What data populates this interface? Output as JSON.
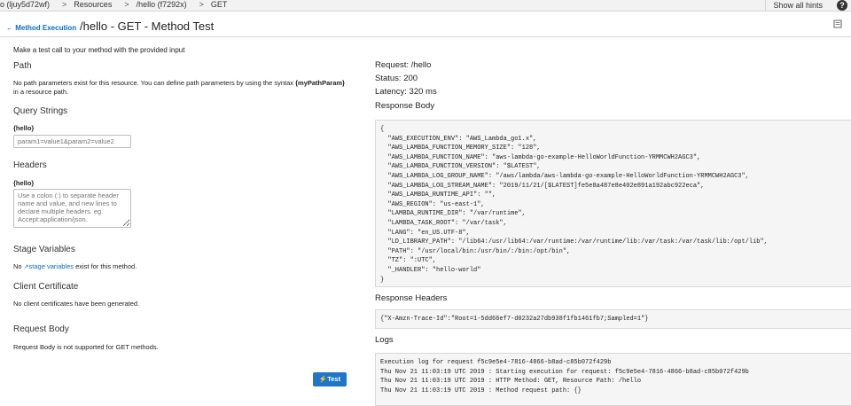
{
  "breadcrumb": {
    "api": "o (ljuy5d72wf)",
    "resources": "Resources",
    "resource": "/hello (f7292x)",
    "method": "GET",
    "sep": ">"
  },
  "header": {
    "show_hints": "Show all hints",
    "help": "?",
    "back_label": "Method Execution",
    "title": "/hello - GET - Method Test"
  },
  "left": {
    "intro": "Make a test call to your method with the provided input",
    "path_title": "Path",
    "path_desc_1": "No path parameters exist for this resource. You can define path parameters by using the syntax ",
    "path_syntax": "{myPathParam}",
    "path_desc_2": "in a resource path.",
    "query_title": "Query Strings",
    "query_label": "{hello}",
    "query_placeholder": "param1=value1&param2=value2",
    "headers_title": "Headers",
    "headers_label": "{hello}",
    "headers_placeholder": "Use a colon (:) to separate header name and value, and new lines to declare multiple headers. eg. Accept:application/json.",
    "stage_title": "Stage Variables",
    "stage_pre": "No ",
    "stage_link": "stage variables",
    "stage_post": " exist for this method.",
    "cert_title": "Client Certificate",
    "cert_desc": "No client certificates have been generated.",
    "body_title": "Request Body",
    "body_desc": "Request Body is not supported for GET methods.",
    "test_button": "Test"
  },
  "right": {
    "request": "Request: /hello",
    "status": "Status: 200",
    "latency": "Latency: 320 ms",
    "response_body_title": "Response Body",
    "response_body": "{\n  \"AWS_EXECUTION_ENV\": \"AWS_Lambda_go1.x\",\n  \"AWS_LAMBDA_FUNCTION_MEMORY_SIZE\": \"128\",\n  \"AWS_LAMBDA_FUNCTION_NAME\": \"aws-lambda-go-example-HelloWorldFunction-YRMMCWH2AGC3\",\n  \"AWS_LAMBDA_FUNCTION_VERSION\": \"$LATEST\",\n  \"AWS_LAMBDA_LOG_GROUP_NAME\": \"/aws/lambda/aws-lambda-go-example-HelloWorldFunction-YRMMCWH2AGC3\",\n  \"AWS_LAMBDA_LOG_STREAM_NAME\": \"2019/11/21/[$LATEST]fe5e8a487e8e402e891a192abc922eca\",\n  \"AWS_LAMBDA_RUNTIME_API\": \"\",\n  \"AWS_REGION\": \"us-east-1\",\n  \"LAMBDA_RUNTIME_DIR\": \"/var/runtime\",\n  \"LAMBDA_TASK_ROOT\": \"/var/task\",\n  \"LANG\": \"en_US.UTF-8\",\n  \"LD_LIBRARY_PATH\": \"/lib64:/usr/lib64:/var/runtime:/var/runtime/lib:/var/task:/var/task/lib:/opt/lib\",\n  \"PATH\": \"/usr/local/bin:/usr/bin/:/bin:/opt/bin\",\n  \"TZ\": \":UTC\",\n  \"_HANDLER\": \"hello-world\"\n}",
    "response_headers_title": "Response Headers",
    "response_headers": "{\"X-Amzn-Trace-Id\":\"Root=1-5dd66ef7-d0232a27db938f1fb1461fb7;Sampled=1\"}",
    "logs_title": "Logs",
    "logs": "Execution log for request f5c9e5e4-7816-4866-b8ad-c85b072f429b\nThu Nov 21 11:03:19 UTC 2019 : Starting execution for request: f5c9e5e4-7816-4866-b8ad-c85b072f429b\nThu Nov 21 11:03:19 UTC 2019 : HTTP Method: GET, Resource Path: /hello\nThu Nov 21 11:03:19 UTC 2019 : Method request path: {}"
  },
  "colors": {
    "accent": "#1f76c7",
    "link": "#0a6ebd"
  }
}
